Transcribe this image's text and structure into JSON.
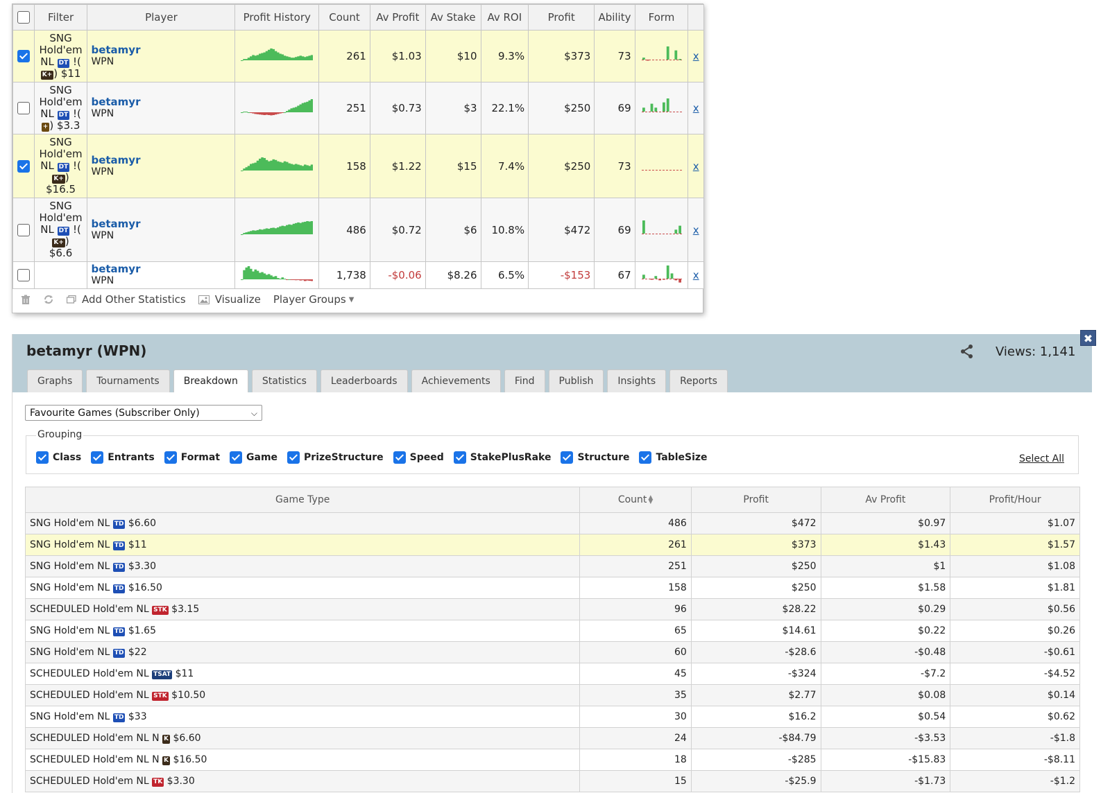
{
  "top_table": {
    "headers": {
      "filter": "Filter",
      "player": "Player",
      "profit_history": "Profit History",
      "count": "Count",
      "av_profit": "Av Profit",
      "av_stake": "Av Stake",
      "av_roi": "Av ROI",
      "profit": "Profit",
      "ability": "Ability",
      "form": "Form"
    },
    "rows": [
      {
        "checked": true,
        "filter": {
          "l1": "SNG",
          "l2": "Hold'em",
          "l3a": "NL",
          "b1": "DT",
          "l3b": "!(",
          "b2": "K+",
          "l4": ") $11",
          "l5": ""
        },
        "player": "betamyr",
        "site": "WPN",
        "count": "261",
        "av_profit": "$1.03",
        "av_stake": "$10",
        "av_roi": "9.3%",
        "profit": "$373",
        "ability": "73",
        "remove": "x",
        "history": [
          0,
          0.1,
          0.1,
          0.2,
          0.3,
          0.4,
          0.35,
          0.4,
          0.5,
          0.55,
          0.6,
          0.7,
          0.8,
          0.9,
          0.85,
          0.7,
          0.6,
          0.5,
          0.45,
          0.35,
          0.3,
          0.25,
          0.2,
          0.2,
          0.25,
          0.3,
          0.35,
          0.3,
          0.25,
          0.3,
          0.35,
          0.4
        ],
        "form": [
          0.15,
          -0.05,
          0,
          0,
          0,
          0,
          1,
          0,
          0.7,
          0.05
        ]
      },
      {
        "checked": false,
        "filter": {
          "l1": "SNG",
          "l2": "Hold'em",
          "l3a": "NL",
          "b1": "DT",
          "l3b": "!(",
          "b2": "+",
          "l4": ") $3.3",
          "l5": ""
        },
        "player": "betamyr",
        "site": "WPN",
        "count": "251",
        "av_profit": "$0.73",
        "av_stake": "$3",
        "av_roi": "22.1%",
        "profit": "$250",
        "ability": "69",
        "remove": "x",
        "history": [
          0,
          0.05,
          0.05,
          0,
          -0.1,
          -0.2,
          -0.3,
          -0.35,
          -0.4,
          -0.45,
          -0.5,
          -0.45,
          -0.5,
          -0.55,
          -0.5,
          -0.4,
          -0.3,
          -0.2,
          -0.1,
          0,
          0.1,
          0.2,
          0.3,
          0.35,
          0.4,
          0.5,
          0.6,
          0.7,
          0.75,
          0.8,
          0.9,
          1.0
        ],
        "form": [
          0.3,
          0,
          0.6,
          0.3,
          0,
          0.7,
          1,
          0,
          0,
          0
        ]
      },
      {
        "checked": true,
        "filter": {
          "l1": "SNG",
          "l2": "Hold'em",
          "l3a": "NL",
          "b1": "DT",
          "l3b": "!(",
          "b2": "K+",
          "l4": ")",
          "l5": "$16.5"
        },
        "player": "betamyr",
        "site": "WPN",
        "count": "158",
        "av_profit": "$1.22",
        "av_stake": "$15",
        "av_roi": "7.4%",
        "profit": "$250",
        "ability": "73",
        "remove": "x",
        "history": [
          0,
          0.15,
          0.25,
          0.35,
          0.5,
          0.55,
          0.6,
          0.75,
          0.9,
          1.0,
          0.95,
          0.8,
          0.7,
          0.75,
          0.85,
          0.8,
          0.7,
          0.65,
          0.6,
          0.7,
          0.65,
          0.55,
          0.5,
          0.45,
          0.5,
          0.45,
          0.4,
          0.35,
          0.45,
          0.4,
          0.35,
          0.45
        ],
        "form": [
          0,
          0,
          0,
          0,
          0,
          0,
          0,
          0,
          0,
          0
        ]
      },
      {
        "checked": false,
        "filter": {
          "l1": "SNG",
          "l2": "Hold'em",
          "l3a": "NL",
          "b1": "DT",
          "l3b": "!(",
          "b2": "K+",
          "l4": ")",
          "l5": "$6.6"
        },
        "player": "betamyr",
        "site": "WPN",
        "count": "486",
        "av_profit": "$0.72",
        "av_stake": "$6",
        "av_roi": "10.8%",
        "profit": "$472",
        "ability": "69",
        "remove": "x",
        "history": [
          0,
          0.1,
          0.15,
          0.2,
          0.25,
          0.3,
          0.28,
          0.32,
          0.38,
          0.35,
          0.4,
          0.45,
          0.42,
          0.48,
          0.5,
          0.46,
          0.52,
          0.6,
          0.65,
          0.62,
          0.7,
          0.75,
          0.72,
          0.8,
          0.85,
          0.9,
          0.86,
          0.92,
          0.95,
          1.0,
          0.97,
          1.0
        ],
        "form": [
          1,
          0,
          0,
          0,
          0,
          0,
          0,
          0,
          0.3,
          0.6
        ]
      },
      {
        "checked": false,
        "filter": null,
        "player": "betamyr",
        "site": "WPN",
        "count": "1,738",
        "av_profit": "-$0.06",
        "av_stake": "$8.26",
        "av_roi": "6.5%",
        "profit": "-$153",
        "ability": "67",
        "remove": "x",
        "history": [
          0,
          0.7,
          0.9,
          1.0,
          0.8,
          0.6,
          0.75,
          0.65,
          0.5,
          0.55,
          0.45,
          0.35,
          0.4,
          0.3,
          0.2,
          0.25,
          0.1,
          0.05,
          0.15,
          0.05,
          -0.05,
          0,
          -0.1,
          -0.05,
          -0.15,
          -0.1,
          -0.2,
          -0.15,
          -0.3,
          -0.2,
          -0.25,
          -0.3
        ],
        "form": [
          0.3,
          0,
          -0.2,
          0.2,
          -0.3,
          -0.2,
          1,
          0.4,
          -0.3,
          -0.7
        ]
      }
    ],
    "footer": {
      "add_stats": "Add Other Statistics",
      "visualize": "Visualize",
      "player_groups": "Player Groups"
    }
  },
  "panel": {
    "title": "betamyr (WPN)",
    "views": "Views: 1,141",
    "close": "✖",
    "tabs": [
      "Graphs",
      "Tournaments",
      "Breakdown",
      "Statistics",
      "Leaderboards",
      "Achievements",
      "Find",
      "Publish",
      "Insights",
      "Reports"
    ],
    "active_tab": "Breakdown",
    "select_value": "Favourite Games (Subscriber Only)",
    "grouping": {
      "legend": "Grouping",
      "items": [
        "Class",
        "Entrants",
        "Format",
        "Game",
        "PrizeStructure",
        "Speed",
        "StakePlusRake",
        "Structure",
        "TableSize"
      ],
      "select_all": "Select All"
    },
    "breakdown": {
      "headers": {
        "game_type": "Game Type",
        "count": "Count",
        "profit": "Profit",
        "av_profit": "Av Profit",
        "profit_hour": "Profit/Hour"
      },
      "rows": [
        {
          "pre": "SNG Hold'em NL",
          "badge": "TD",
          "post": "$6.60",
          "count": "486",
          "profit": "$472",
          "av_profit": "$0.97",
          "profit_hour": "$1.07"
        },
        {
          "pre": "SNG Hold'em NL",
          "badge": "TD",
          "post": "$11",
          "count": "261",
          "profit": "$373",
          "av_profit": "$1.43",
          "profit_hour": "$1.57"
        },
        {
          "pre": "SNG Hold'em NL",
          "badge": "TD",
          "post": "$3.30",
          "count": "251",
          "profit": "$250",
          "av_profit": "$1",
          "profit_hour": "$1.08"
        },
        {
          "pre": "SNG Hold'em NL",
          "badge": "TD",
          "post": "$16.50",
          "count": "158",
          "profit": "$250",
          "av_profit": "$1.58",
          "profit_hour": "$1.81"
        },
        {
          "pre": "SCHEDULED Hold'em NL",
          "badge": "STK",
          "post": "$3.15",
          "count": "96",
          "profit": "$28.22",
          "av_profit": "$0.29",
          "profit_hour": "$0.56"
        },
        {
          "pre": "SNG Hold'em NL",
          "badge": "TD",
          "post": "$1.65",
          "count": "65",
          "profit": "$14.61",
          "av_profit": "$0.22",
          "profit_hour": "$0.26"
        },
        {
          "pre": "SNG Hold'em NL",
          "badge": "TD",
          "post": "$22",
          "count": "60",
          "profit": "-$28.6",
          "av_profit": "-$0.48",
          "profit_hour": "-$0.61"
        },
        {
          "pre": "SCHEDULED Hold'em NL",
          "badge": "TSAT",
          "post": "$11",
          "count": "45",
          "profit": "-$324",
          "av_profit": "-$7.2",
          "profit_hour": "-$4.52"
        },
        {
          "pre": "SCHEDULED Hold'em NL",
          "badge": "STK",
          "post": "$10.50",
          "count": "35",
          "profit": "$2.77",
          "av_profit": "$0.08",
          "profit_hour": "$0.14"
        },
        {
          "pre": "SNG Hold'em NL",
          "badge": "TD",
          "post": "$33",
          "count": "30",
          "profit": "$16.2",
          "av_profit": "$0.54",
          "profit_hour": "$0.62"
        },
        {
          "pre": "SCHEDULED Hold'em NL N",
          "badge": "K",
          "post": "$6.60",
          "count": "24",
          "profit": "-$84.79",
          "av_profit": "-$3.53",
          "profit_hour": "-$1.8"
        },
        {
          "pre": "SCHEDULED Hold'em NL N",
          "badge": "K",
          "post": "$16.50",
          "count": "18",
          "profit": "-$285",
          "av_profit": "-$15.83",
          "profit_hour": "-$8.11"
        },
        {
          "pre": "SCHEDULED Hold'em NL",
          "badge": "TK",
          "post": "$3.30",
          "count": "15",
          "profit": "-$25.9",
          "av_profit": "-$1.73",
          "profit_hour": "-$1.2"
        }
      ]
    }
  },
  "colors": {
    "positive_green": "#4cbb5a",
    "negative_red": "#c94c4c",
    "link_blue": "#1a5ca8",
    "selected_row": "#fbfbd0",
    "header_band": "#b9cdd6"
  },
  "icons": {
    "delete": "trash-icon",
    "refresh": "refresh-icon",
    "add_stats": "window-icon",
    "visualize": "image-icon",
    "share": "share-icon",
    "close": "close-icon"
  }
}
